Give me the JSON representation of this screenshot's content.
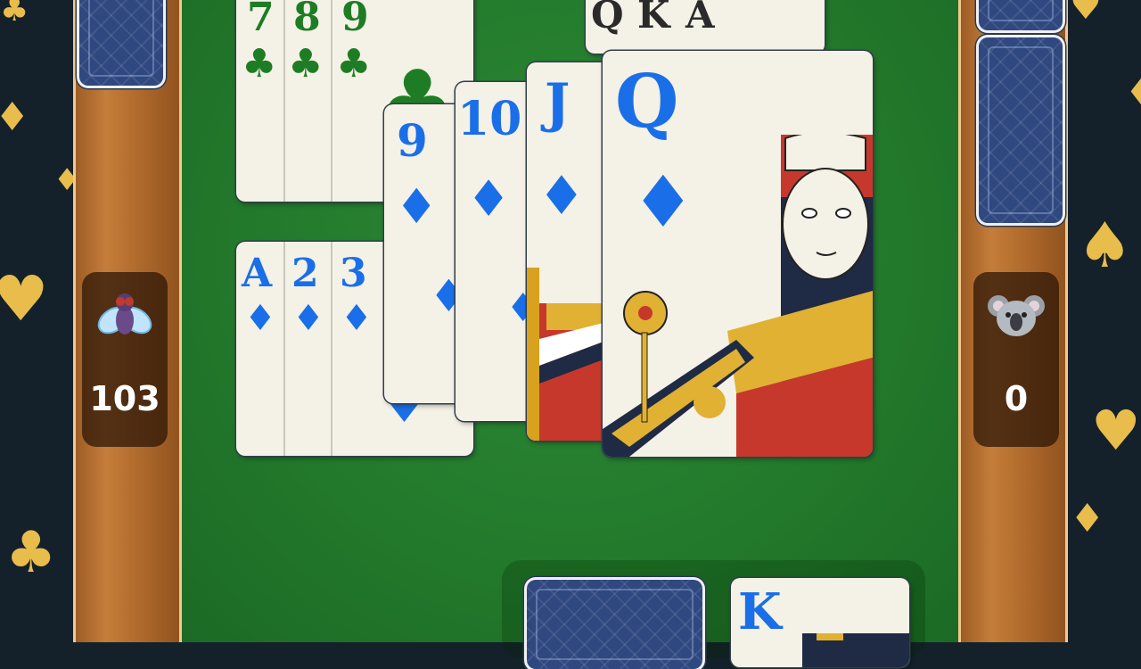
{
  "players": {
    "left": {
      "avatar": "fly-avatar",
      "score": "103"
    },
    "right": {
      "avatar": "koala-avatar",
      "score": "0"
    }
  },
  "melds": {
    "clubs": [
      {
        "rank": "7",
        "suit": "♣"
      },
      {
        "rank": "8",
        "suit": "♣"
      },
      {
        "rank": "9",
        "suit": "♣"
      }
    ],
    "top_right": [
      {
        "rank": "Q"
      },
      {
        "rank": "K"
      },
      {
        "rank": "A"
      }
    ],
    "diamonds_low": [
      {
        "rank": "A",
        "suit": "♦"
      },
      {
        "rank": "2",
        "suit": "♦"
      },
      {
        "rank": "3",
        "suit": "♦"
      }
    ],
    "diamonds_high": [
      {
        "rank": "9",
        "suit": "♦"
      },
      {
        "rank": "10",
        "suit": "♦"
      },
      {
        "rank": "J",
        "suit": "♦"
      },
      {
        "rank": "Q",
        "suit": "♦"
      }
    ]
  },
  "bottom": {
    "face_card": {
      "rank": "K"
    }
  },
  "colors": {
    "felt": "#237a2c",
    "diamond": "#1a6fe8",
    "club": "#1e7d24",
    "card_back": "#2f4880",
    "decoration": "#e9bd4c"
  }
}
